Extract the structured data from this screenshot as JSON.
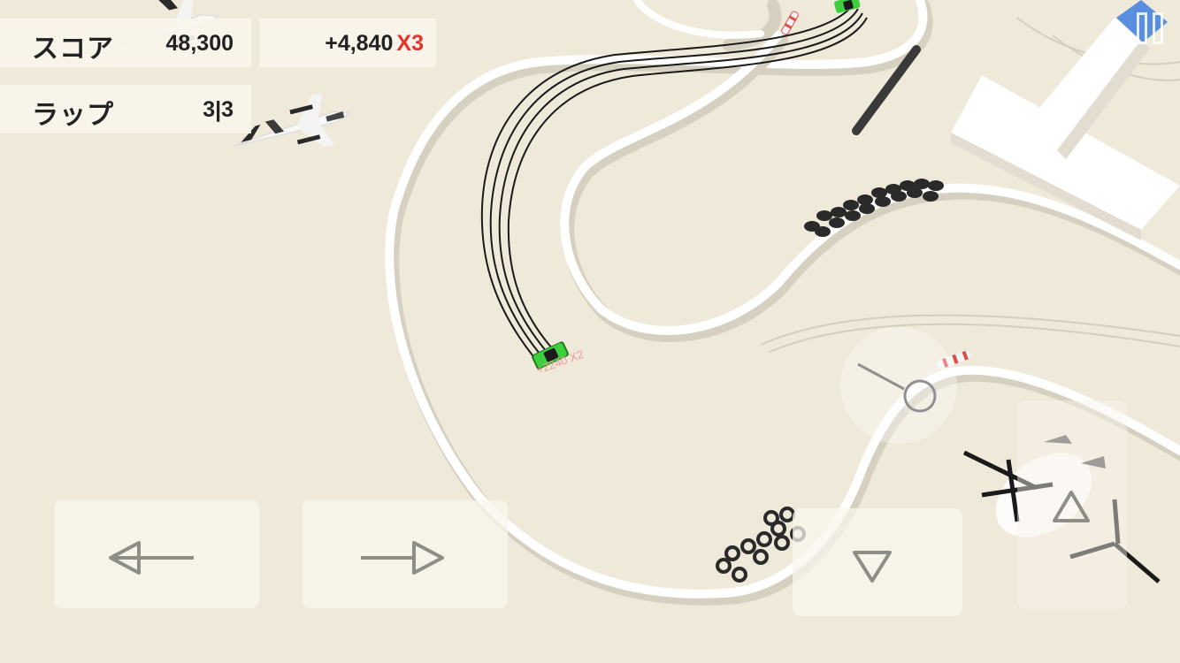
{
  "hud": {
    "score_label": "スコア",
    "score_value": "48,300",
    "lap_label": "ラップ",
    "lap_value": "3|3",
    "bonus_points": "+4,840",
    "bonus_multiplier": "X3"
  },
  "floating_score": "+2240 X2",
  "controls": {
    "left": "steer-left-arrow-icon",
    "right": "steer-right-arrow-icon",
    "brake": "brake-triangle-down-icon",
    "accelerate": "accelerate-triangle-up-icon",
    "pause": "pause-icon"
  },
  "colors": {
    "background": "#efe9d9",
    "track_edge": "#ffffff",
    "player_car": "#3ecf3e",
    "multiplier": "#e3342c",
    "floating_score": "#f29a9a"
  }
}
